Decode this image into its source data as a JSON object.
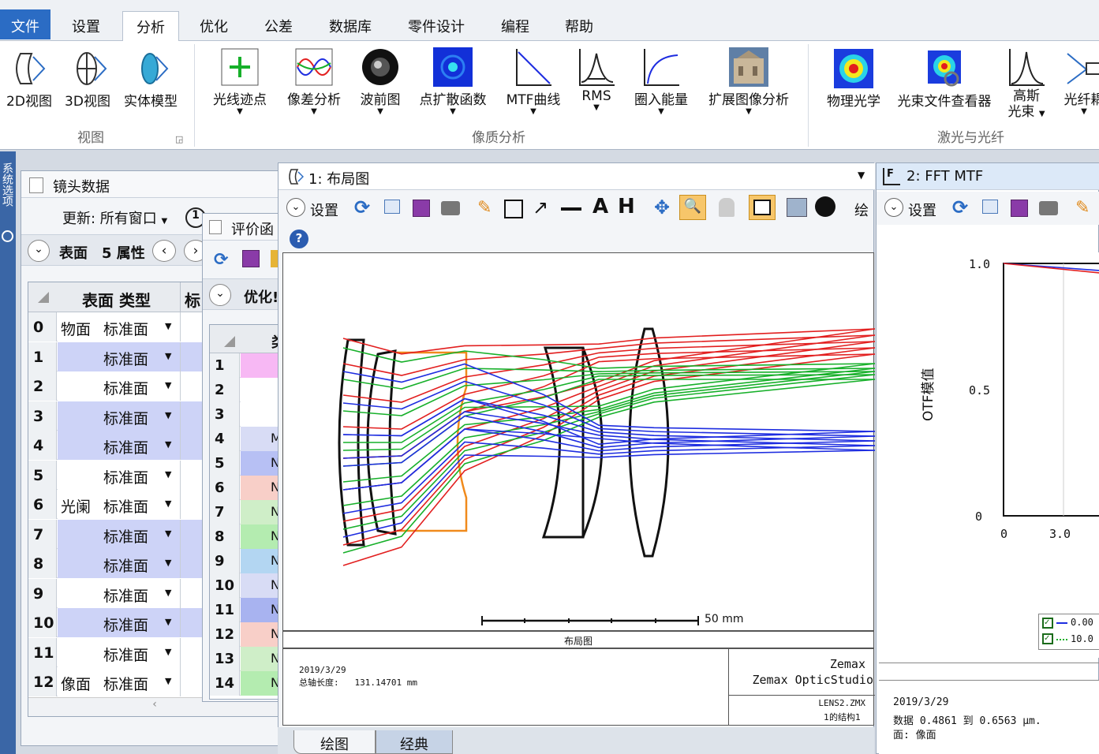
{
  "menu": [
    "文件",
    "设置",
    "分析",
    "优化",
    "公差",
    "数据库",
    "零件设计",
    "编程",
    "帮助"
  ],
  "ribbon": {
    "view_items": [
      "2D视图",
      "3D视图",
      "实体模型"
    ],
    "view_group": "视图",
    "quality_items": [
      "光线迹点",
      "像差分析",
      "波前图",
      "点扩散函数",
      "MTF曲线",
      "RMS",
      "圈入能量",
      "扩展图像分析"
    ],
    "quality_group": "像质分析",
    "laser_items": [
      "物理光学",
      "光束文件查看器",
      "高斯",
      "光束",
      "光纤耦"
    ],
    "laser_group": "激光与光纤"
  },
  "side_strip_label": "系统选项",
  "lens_data": {
    "title": "镜头数据",
    "update_label": "更新: 所有窗口",
    "surface_label": "表面",
    "props_label": "5 属性",
    "col_type": "表面 类型",
    "col_next": "标",
    "rows": [
      {
        "n": "0",
        "comment": "物面",
        "type": "标准面",
        "hl": false
      },
      {
        "n": "1",
        "comment": "",
        "type": "标准面",
        "hl": true
      },
      {
        "n": "2",
        "comment": "",
        "type": "标准面",
        "hl": false
      },
      {
        "n": "3",
        "comment": "",
        "type": "标准面",
        "hl": true
      },
      {
        "n": "4",
        "comment": "",
        "type": "标准面",
        "hl": true
      },
      {
        "n": "5",
        "comment": "",
        "type": "标准面",
        "hl": false
      },
      {
        "n": "6",
        "comment": "光阑",
        "type": "标准面",
        "hl": false
      },
      {
        "n": "7",
        "comment": "",
        "type": "标准面",
        "hl": true
      },
      {
        "n": "8",
        "comment": "",
        "type": "标准面",
        "hl": true
      },
      {
        "n": "9",
        "comment": "",
        "type": "标准面",
        "hl": false
      },
      {
        "n": "10",
        "comment": "",
        "type": "标准面",
        "hl": true
      },
      {
        "n": "11",
        "comment": "",
        "type": "标准面",
        "hl": false
      },
      {
        "n": "12",
        "comment": "像面",
        "type": "标准面",
        "hl": false
      }
    ]
  },
  "merit": {
    "title": "评价函",
    "opt_label": "优化!",
    "rows": [
      "1",
      "2",
      "3",
      "4",
      "5",
      "6",
      "7",
      "8",
      "9",
      "10",
      "11",
      "12",
      "13",
      "14"
    ],
    "col2": [
      "",
      "",
      "",
      "M",
      "N",
      "N",
      "N",
      "N",
      "N",
      "N",
      "N",
      "N",
      "N",
      "N"
    ],
    "col2b": [
      "",
      "",
      "",
      "",
      "",
      "",
      "",
      "",
      "",
      "",
      "",
      "",
      "",
      ""
    ]
  },
  "layout": {
    "title": "1: 布局图",
    "settings": "设置",
    "draw_label": "绘",
    "scale_label": "50 mm",
    "caption": "布局图",
    "date": "2019/3/29",
    "length_line": "总轴长度:   131.14701 mm",
    "company1": "Zemax",
    "company2": "Zemax OpticStudio",
    "file": "LENS2.ZMX",
    "config": "1的结构1",
    "tabs": [
      "绘图",
      "经典"
    ]
  },
  "mtf": {
    "title": "2: FFT MTF",
    "settings": "设置",
    "ylabel": "OTF模值",
    "yticks": [
      "1.0",
      "0.5",
      "0"
    ],
    "xticks": [
      "0",
      "3.0"
    ],
    "legend": [
      "0.00",
      "10.0"
    ],
    "date": "2019/3/29",
    "data_line": "数据 0.4861 到 0.6563 μm.",
    "surface_line": "面: 像面"
  },
  "chart_data": {
    "type": "line",
    "ylabel": "OTF模值",
    "ylim": [
      0,
      1.0
    ],
    "xticks": [
      "0",
      "3.0"
    ],
    "series": [
      {
        "name": "0.00",
        "values": [
          1.0,
          0.97
        ]
      },
      {
        "name": "10.0",
        "values": [
          1.0,
          0.96
        ]
      }
    ]
  },
  "colors": {
    "ray_red": "#e21f1f",
    "ray_green": "#17b02a",
    "ray_blue": "#1e2de0",
    "accent": "#2b6cc4",
    "lens_orange": "#f08a1c"
  }
}
